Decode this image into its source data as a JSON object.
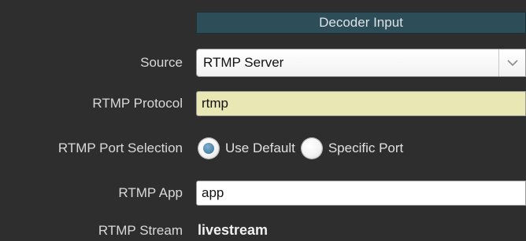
{
  "panel": {
    "title": "Decoder Input"
  },
  "fields": {
    "source": {
      "label": "Source",
      "value": "RTMP Server"
    },
    "protocol": {
      "label": "RTMP Protocol",
      "value": "rtmp"
    },
    "port_selection": {
      "label": "RTMP Port Selection",
      "options": [
        {
          "label": "Use Default",
          "checked": true
        },
        {
          "label": "Specific Port",
          "checked": false
        }
      ]
    },
    "app": {
      "label": "RTMP App",
      "value": "app"
    },
    "stream": {
      "label": "RTMP Stream",
      "value": "livestream"
    }
  },
  "colors": {
    "background": "#2e2e2e",
    "header": "#2d4d59",
    "protocol_field": "#e9e7b3",
    "radio_selected": "#4a82a6"
  },
  "icons": {
    "select_arrow": "chevron-down-icon"
  }
}
